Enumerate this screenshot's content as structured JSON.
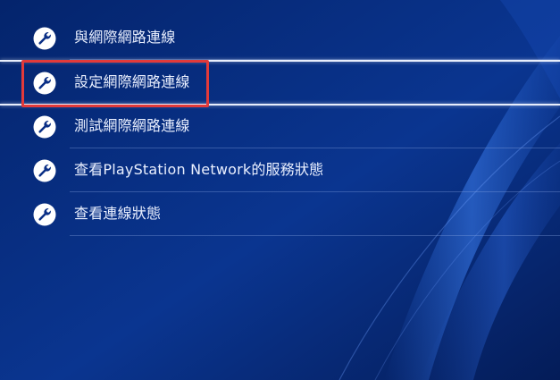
{
  "menu": {
    "items": [
      {
        "label": "與網際網路連線",
        "icon": "wrench-icon"
      },
      {
        "label": "設定網際網路連線",
        "icon": "wrench-icon",
        "selected": true
      },
      {
        "label": "測試網際網路連線",
        "icon": "wrench-icon"
      },
      {
        "label": "查看PlayStation Network的服務狀態",
        "icon": "wrench-icon"
      },
      {
        "label": "查看連線狀態",
        "icon": "wrench-icon"
      }
    ]
  },
  "colors": {
    "background": "#062a7a",
    "highlight_box": "#e23a3a",
    "text": "#eaf0ff"
  }
}
